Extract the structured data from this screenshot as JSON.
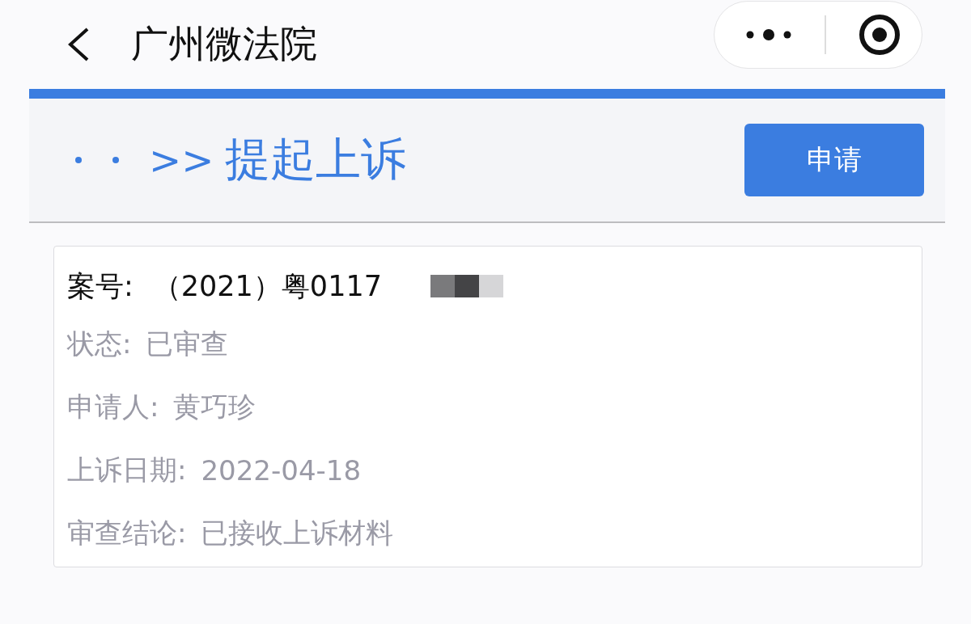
{
  "nav": {
    "title": "广州微法院"
  },
  "section": {
    "prefix": ">>",
    "title": "提起上诉",
    "button": "申请"
  },
  "case": {
    "number_label": "案号:",
    "number": "（2021）粤0117",
    "fields": [
      {
        "label": "状态:",
        "value": "已审查"
      },
      {
        "label": "申请人:",
        "value": "黄巧珍"
      },
      {
        "label": "上诉日期:",
        "value": "2022-04-18"
      },
      {
        "label": "审查结论:",
        "value": "已接收上诉材料"
      }
    ]
  }
}
